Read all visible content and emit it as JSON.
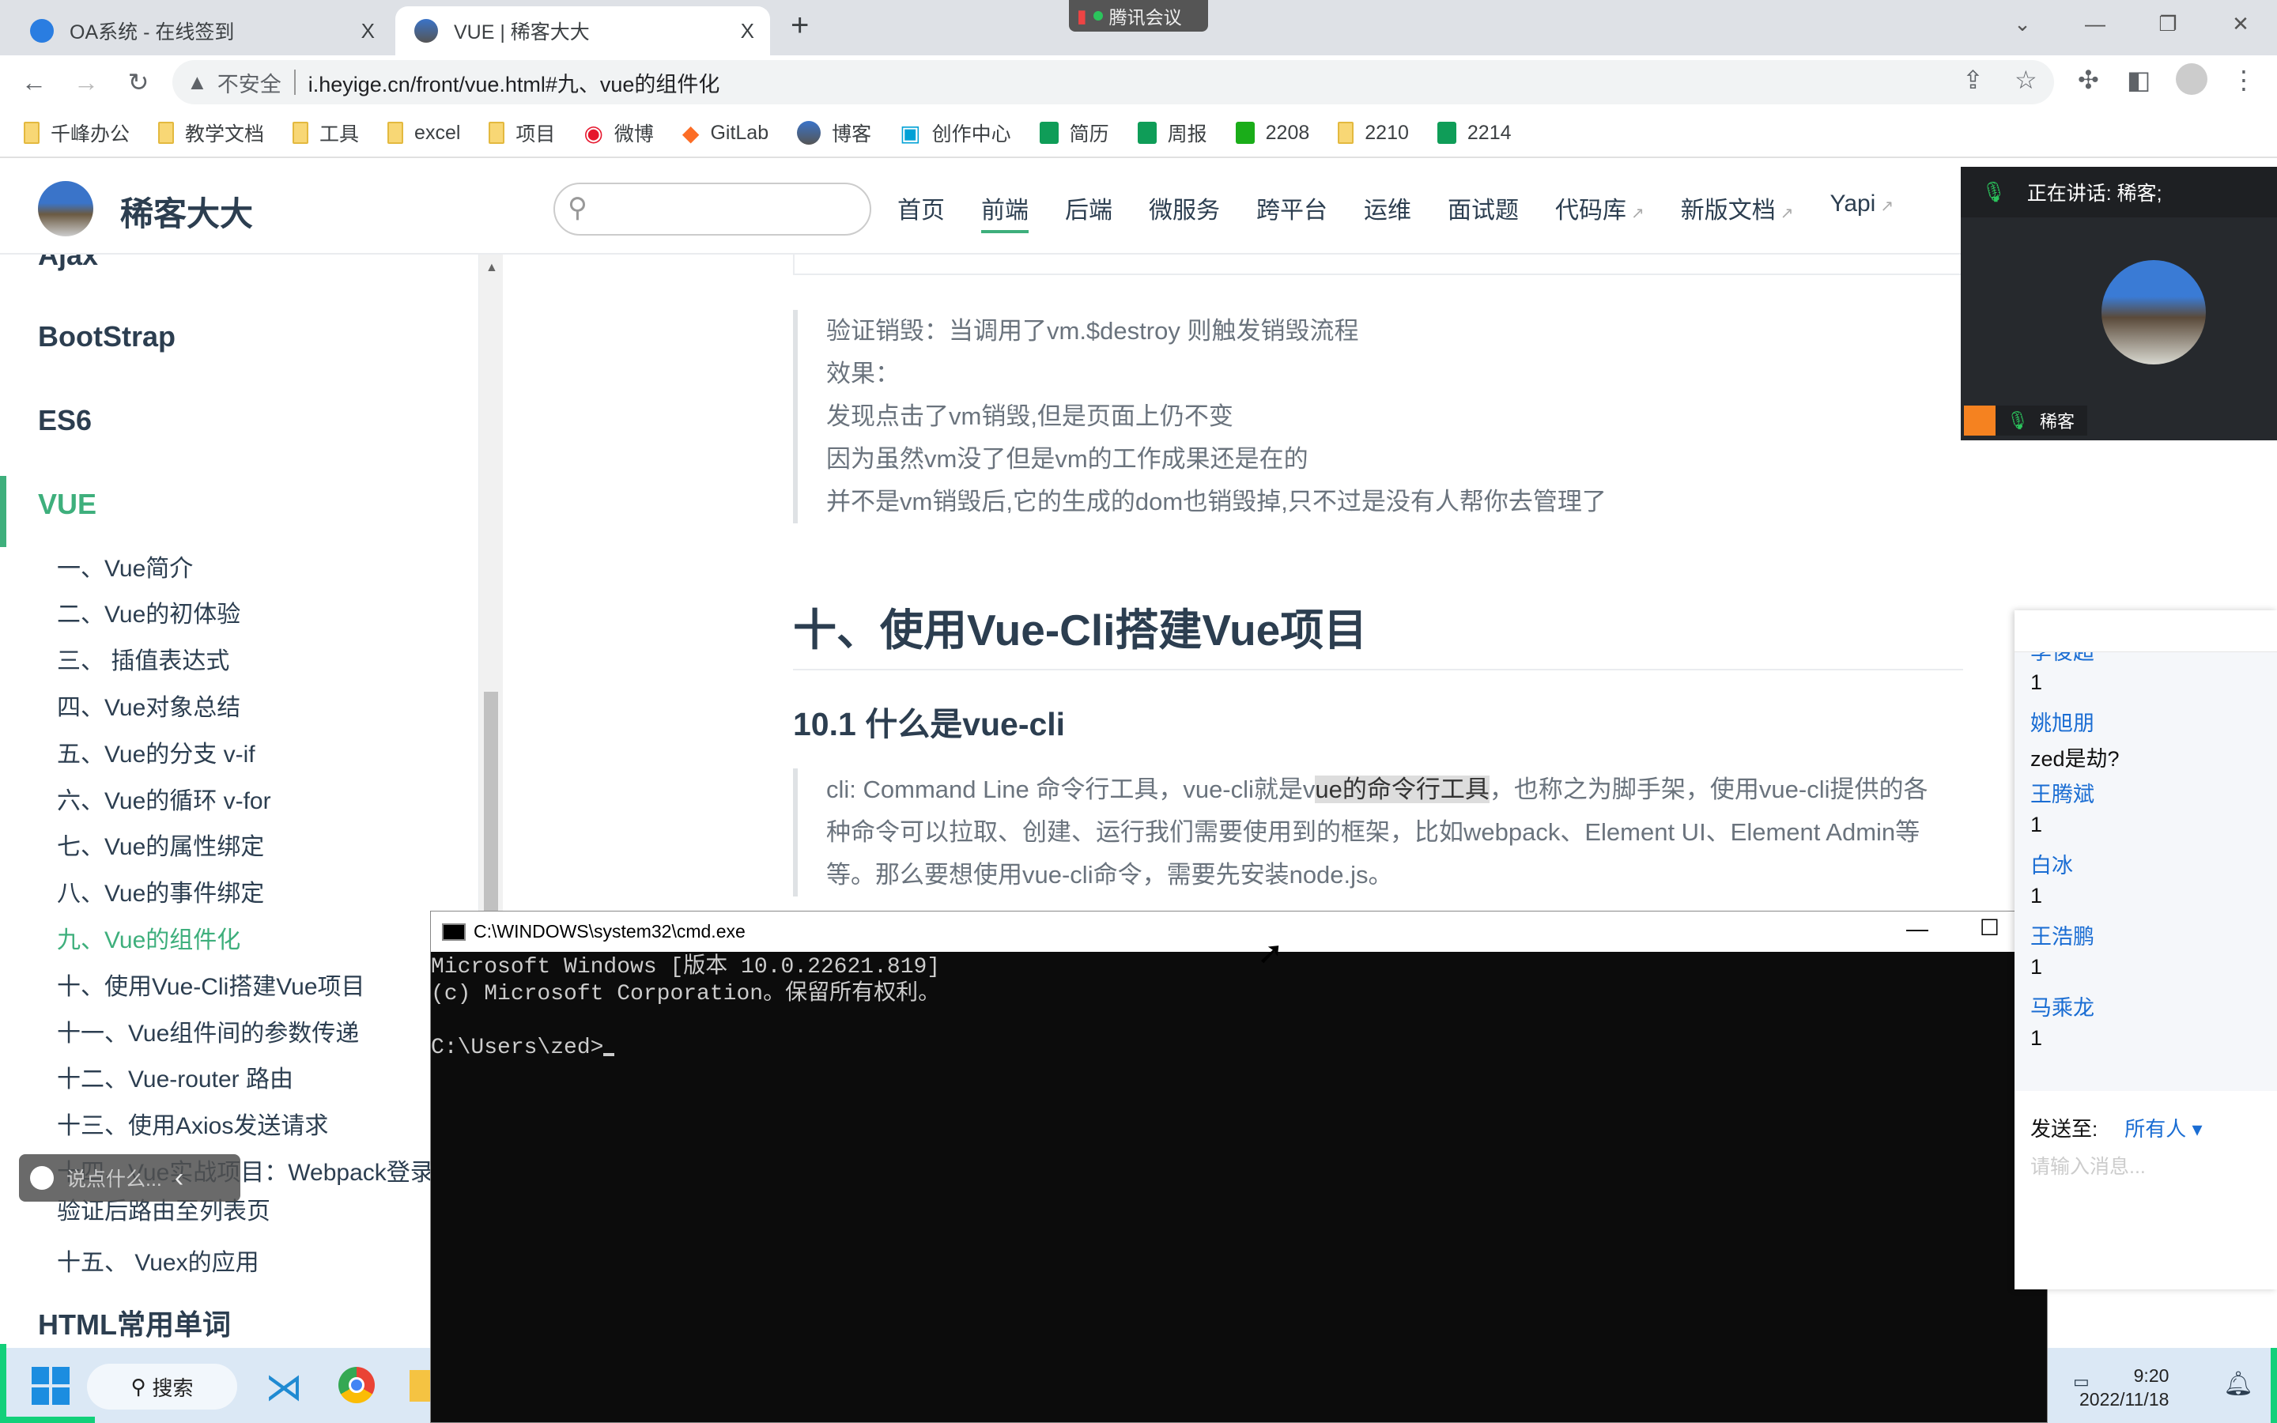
{
  "browser": {
    "tabs": [
      {
        "title": "OA系统 - 在线签到",
        "close": "X"
      },
      {
        "title": "VUE | 稀客大大",
        "close": "X"
      }
    ],
    "new_tab": "+",
    "security": "不安全",
    "url": "i.heyige.cn/front/vue.html#九、vue的组件化",
    "bookmarks": [
      "千峰办公",
      "教学文档",
      "工具",
      "excel",
      "项目",
      "微博",
      "GitLab",
      "博客",
      "创作中心",
      "简历",
      "周报",
      "2208",
      "2210",
      "2214"
    ]
  },
  "meeting_float": "腾讯会议",
  "site": {
    "name": "稀客大大",
    "nav": [
      {
        "label": "首页"
      },
      {
        "label": "前端",
        "active": true
      },
      {
        "label": "后端"
      },
      {
        "label": "微服务"
      },
      {
        "label": "跨平台"
      },
      {
        "label": "运维"
      },
      {
        "label": "面试题"
      },
      {
        "label": "代码库",
        "external": true
      },
      {
        "label": "新版文档",
        "external": true
      },
      {
        "label": "Yapi",
        "external": true
      }
    ]
  },
  "sidebar": {
    "sections": [
      "Ajax",
      "BootStrap",
      "ES6",
      "VUE"
    ],
    "vue_items": [
      "一、Vue简介",
      "二、Vue的初体验",
      "三、 插值表达式",
      "四、Vue对象总结",
      "五、Vue的分支 v-if",
      "六、Vue的循环 v-for",
      "七、Vue的属性绑定",
      "八、Vue的事件绑定",
      "九、Vue的组件化",
      "十、使用Vue-Cli搭建Vue项目",
      "十一、Vue组件间的参数传递",
      "十二、Vue-router 路由",
      "十三、使用Axios发送请求",
      "十四、Vue实战项目：Webpack登录",
      "验证后路由至列表页",
      "十五、 Vuex的应用"
    ],
    "active_item": "九、Vue的组件化",
    "next_section": "HTML常用单词",
    "accent": "#3eaf7c"
  },
  "content": {
    "quote1": [
      "验证销毁：当调用了vm.$destroy 则触发销毁流程",
      "效果：",
      "发现点击了vm销毁,但是页面上仍不变",
      "因为虽然vm没了但是vm的工作成果还是在的",
      "并不是vm销毁后,它的生成的dom也销毁掉,只不过是没有人帮你去管理了"
    ],
    "h2": "十、使用Vue-Cli搭建Vue项目",
    "h3": "10.1 什么是vue-cli",
    "q2_pre": "cli: Command Line 命令行工具，vue-cli就是v",
    "q2_hl": "ue的命令行工具",
    "q2_post": "，也称之为脚手架，使用vue-cli提供的各",
    "q2_l2": "种命令可以拉取、创建、运行我们需要使用到的框架，比如webpack、Element UI、Element Admin等",
    "q2_l3": "等。那么要想使用vue-cli命令，需要先安装node.js。"
  },
  "cmd": {
    "title": "C:\\WINDOWS\\system32\\cmd.exe",
    "lines": [
      "Microsoft Windows [版本 10.0.22621.819]",
      "(c) Microsoft Corporation。保留所有权利。",
      "",
      "C:\\Users\\zed>"
    ]
  },
  "video": {
    "speaking": "正在讲话: 稀客;",
    "name": "稀客"
  },
  "chat": {
    "messages": [
      {
        "name": "李俊超",
        "text": "1"
      },
      {
        "name": "姚旭朋",
        "text": "zed是劫?"
      },
      {
        "name": "王腾斌",
        "text": "1"
      },
      {
        "name": "白冰",
        "text": "1"
      },
      {
        "name": "王浩鹏",
        "text": "1"
      },
      {
        "name": "马乘龙",
        "text": "1"
      }
    ],
    "send_to_label": "发送至:",
    "send_to_value": "所有人 ▾",
    "placeholder": "请输入消息..."
  },
  "say_bar": {
    "placeholder": "说点什么...",
    "arrow": "‹"
  },
  "taskbar": {
    "search": "搜索",
    "time": "9:20",
    "date": "2022/11/18"
  }
}
